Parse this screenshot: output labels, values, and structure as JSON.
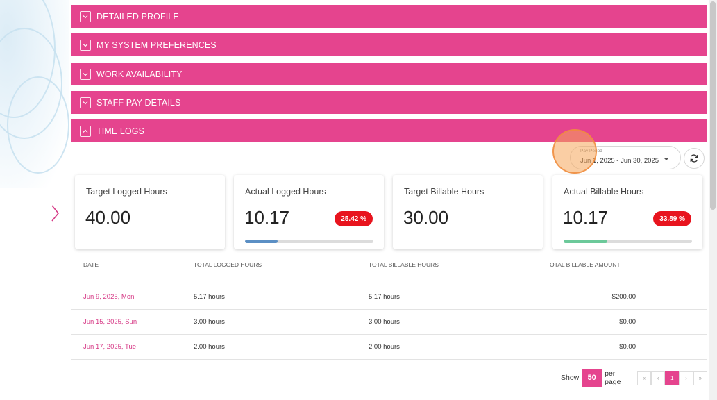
{
  "accent_color": "#e5448e",
  "sections": [
    {
      "title": "DETAILED PROFILE",
      "expanded": false
    },
    {
      "title": "MY SYSTEM PREFERENCES",
      "expanded": false
    },
    {
      "title": "WORK AVAILABILITY",
      "expanded": false
    },
    {
      "title": "STAFF PAY DETAILS",
      "expanded": false
    },
    {
      "title": "TIME LOGS",
      "expanded": true
    }
  ],
  "pay_period": {
    "label": "Pay Period",
    "value": "Jun 1, 2025 - Jun 30, 2025"
  },
  "cards": [
    {
      "title": "Target Logged Hours",
      "value": "40.00"
    },
    {
      "title": "Actual Logged Hours",
      "value": "10.17",
      "badge": "25.42 %",
      "progress": 0.2542,
      "bar_color": "#5b8fc4"
    },
    {
      "title": "Target Billable Hours",
      "value": "30.00"
    },
    {
      "title": "Actual Billable Hours",
      "value": "10.17",
      "badge": "33.89 %",
      "progress": 0.3389,
      "bar_color": "#6cc99a"
    }
  ],
  "table": {
    "headers": [
      "DATE",
      "TOTAL LOGGED HOURS",
      "TOTAL BILLABLE HOURS",
      "TOTAL BILLABLE AMOUNT"
    ],
    "rows": [
      {
        "date": "Jun 9, 2025, Mon",
        "logged": "5.17 hours",
        "billable": "5.17 hours",
        "amount": "$200.00"
      },
      {
        "date": "Jun 15, 2025, Sun",
        "logged": "3.00 hours",
        "billable": "3.00 hours",
        "amount": "$0.00"
      },
      {
        "date": "Jun 17, 2025, Tue",
        "logged": "2.00 hours",
        "billable": "2.00 hours",
        "amount": "$0.00"
      }
    ]
  },
  "pagination": {
    "show_label": "Show",
    "per_page_value": "50",
    "per_page_label": "per page",
    "first": "«",
    "prev": "‹",
    "current_page": "1",
    "next": "›",
    "last": "»"
  }
}
